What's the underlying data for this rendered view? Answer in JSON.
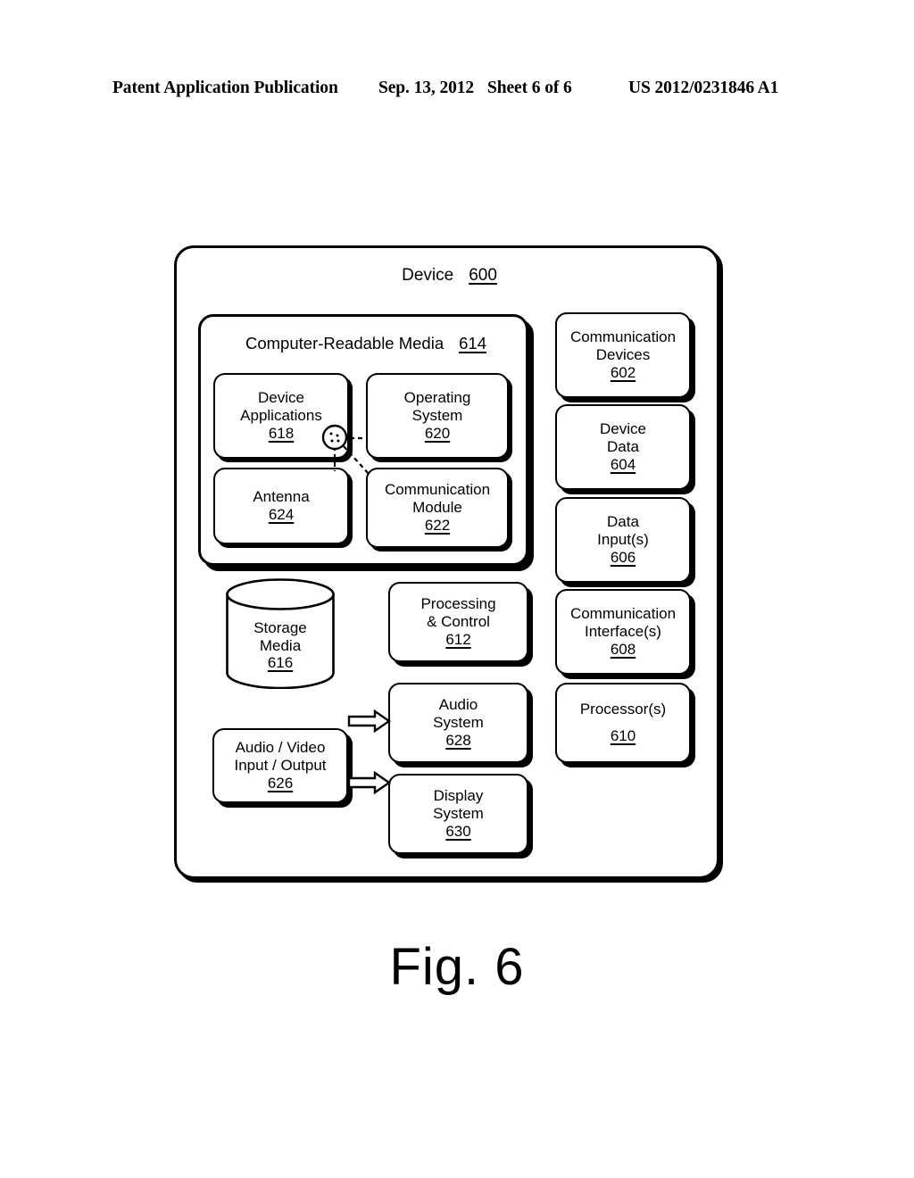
{
  "header": {
    "publication": "Patent Application Publication",
    "date": "Sep. 13, 2012",
    "sheet": "Sheet 6 of 6",
    "number": "US 2012/0231846 A1"
  },
  "figure": {
    "caption": "Fig. 6"
  },
  "diagram": {
    "device": {
      "label": "Device",
      "ref": "600"
    },
    "computer_readable_media": {
      "label": "Computer-Readable Media",
      "ref": "614"
    },
    "crm_children": [
      {
        "lines": [
          "Device",
          "Applications"
        ],
        "ref": "618",
        "name": "device-applications"
      },
      {
        "lines": [
          "Operating",
          "System"
        ],
        "ref": "620",
        "name": "operating-system"
      },
      {
        "lines": [
          "Antenna"
        ],
        "ref": "624",
        "name": "antenna"
      },
      {
        "lines": [
          "Communication",
          "Module"
        ],
        "ref": "622",
        "name": "communication-module"
      }
    ],
    "storage_media": {
      "lines": [
        "Storage",
        "Media"
      ],
      "ref": "616"
    },
    "middle_column": [
      {
        "lines": [
          "Processing",
          "& Control"
        ],
        "ref": "612",
        "name": "processing-and-control"
      },
      {
        "lines": [
          "Audio",
          "System"
        ],
        "ref": "628",
        "name": "audio-system"
      },
      {
        "lines": [
          "Display",
          "System"
        ],
        "ref": "630",
        "name": "display-system"
      }
    ],
    "av_io": {
      "lines": [
        "Audio / Video",
        "Input / Output"
      ],
      "ref": "626"
    },
    "right_column": [
      {
        "lines": [
          "Communication",
          "Devices"
        ],
        "ref": "602",
        "name": "communication-devices"
      },
      {
        "lines": [
          "Device",
          "Data"
        ],
        "ref": "604",
        "name": "device-data"
      },
      {
        "lines": [
          "Data",
          "Input(s)"
        ],
        "ref": "606",
        "name": "data-inputs"
      },
      {
        "lines": [
          "Communication",
          "Interface(s)"
        ],
        "ref": "608",
        "name": "communication-interfaces"
      },
      {
        "lines": [
          "Processor(s)"
        ],
        "ref": "610",
        "name": "processors"
      }
    ],
    "colors": {
      "stroke": "#000000",
      "background": "#ffffff"
    }
  }
}
